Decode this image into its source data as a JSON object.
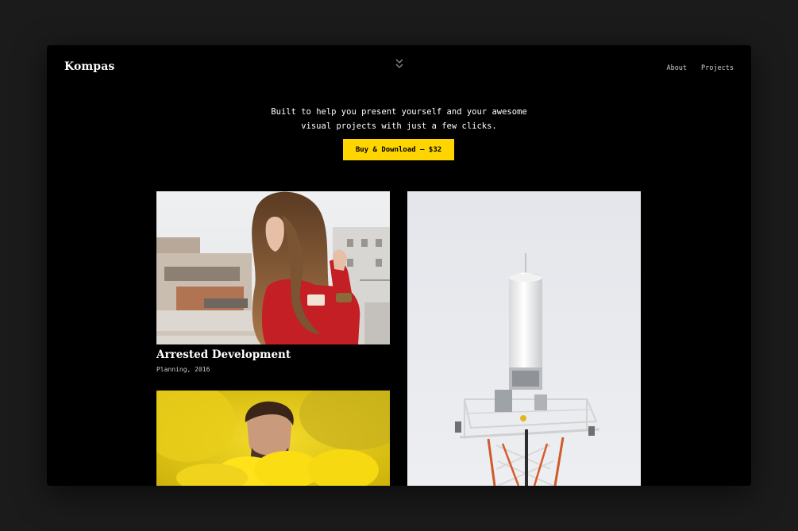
{
  "header": {
    "logo": "Kompas",
    "nav": [
      {
        "label": "About"
      },
      {
        "label": "Projects"
      }
    ],
    "scroll_icon": "double-chevron-down-icon"
  },
  "hero": {
    "tagline_line1": "Built to help you present yourself and your awesome",
    "tagline_line2": "visual projects with just a few clicks.",
    "cta_label": "Buy & Download — $32"
  },
  "projects": [
    {
      "title": "Arrested Development",
      "meta": "Planning, 2016",
      "image": "woman-red-sweater-photo"
    },
    {
      "title": "",
      "meta": "",
      "image": "antenna-tower-photo"
    },
    {
      "title": "",
      "meta": "",
      "image": "yellow-smoke-portrait-photo"
    }
  ],
  "colors": {
    "accent": "#ffd500",
    "background": "#000000",
    "outer_background": "#1b1b1b",
    "text": "#ffffff"
  }
}
